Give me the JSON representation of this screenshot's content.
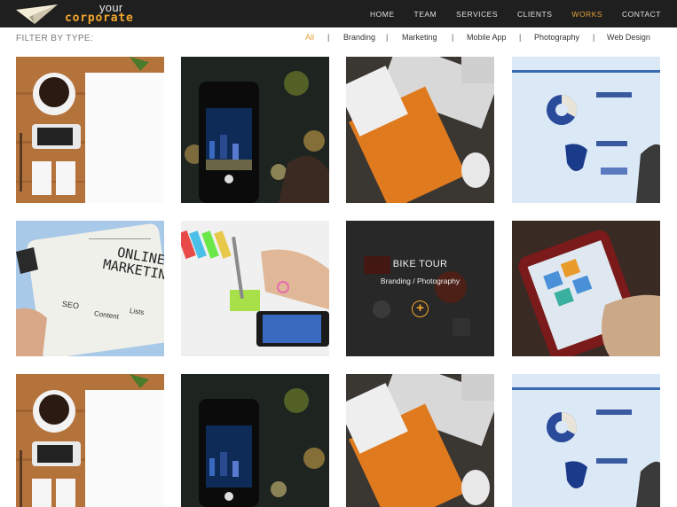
{
  "logo": {
    "line1": "your",
    "line2": "corporate"
  },
  "nav": [
    "HOME",
    "TEAM",
    "SERVICES",
    "CLIENTS",
    "WORKS",
    "CONTACT"
  ],
  "nav_active": "WORKS",
  "filter": {
    "label": "FILTER BY TYPE:",
    "options": [
      "All",
      "Branding",
      "Marketing",
      "Mobile App",
      "Photography",
      "Web Design"
    ],
    "separator": "|",
    "active": "All"
  },
  "portfolio": {
    "hover_item": {
      "title": "BIKE TOUR",
      "categories": "Branding / Photography",
      "plus": "+"
    },
    "tablet_text": {
      "line1": "ONLINE",
      "line2": "MARKETING",
      "words": [
        "SEO",
        "Content",
        "Lists"
      ]
    }
  },
  "colors": {
    "accent": "#e3a03a",
    "header_bg": "#1f1f1f"
  }
}
